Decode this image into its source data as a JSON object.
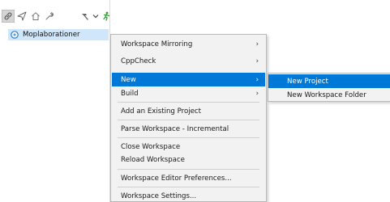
{
  "explorer": {
    "project_name": "Moplaborationer",
    "toolbar_icons": [
      "link-icon",
      "send-icon",
      "home-icon",
      "wrench-icon",
      "hammer-icon",
      "chevron-down-icon",
      "run-icon"
    ]
  },
  "context_menu": {
    "items": [
      {
        "label": "Workspace Mirroring",
        "submenu": true
      },
      {
        "label": "CppCheck",
        "submenu": true
      },
      {
        "label": "New",
        "submenu": true,
        "active": true
      },
      {
        "label": "Build",
        "submenu": true
      },
      {
        "label": "Add an Existing Project"
      },
      {
        "label": "Parse Workspace - Incremental"
      },
      {
        "label": "Close Workspace"
      },
      {
        "label": "Reload Workspace"
      },
      {
        "label": "Workspace Editor Preferences..."
      },
      {
        "label": "Workspace Settings..."
      }
    ],
    "submenu_arrow": "›"
  },
  "new_submenu": {
    "items": [
      {
        "label": "New Project",
        "active": true
      },
      {
        "label": "New Workspace Folder"
      }
    ]
  },
  "colors": {
    "highlight": "#0078d7",
    "tree_selection": "#cfe6fb",
    "menu_background": "#f2f2f2",
    "run_icon": "#2e9e2e"
  }
}
